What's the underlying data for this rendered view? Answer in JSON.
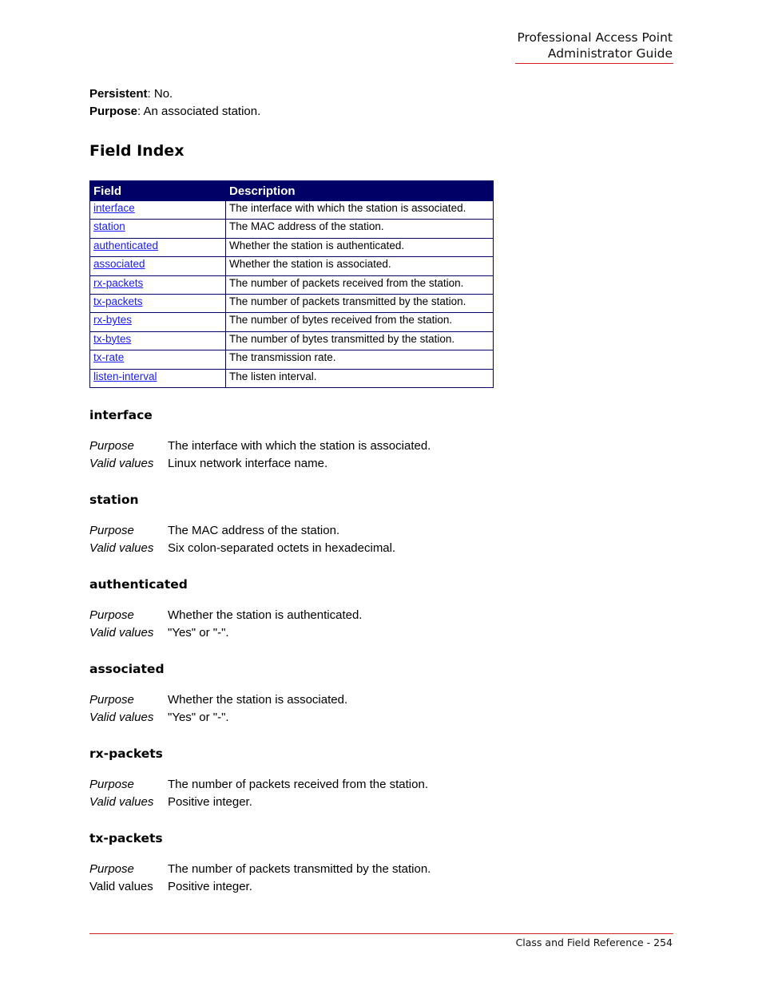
{
  "header": {
    "line1": "Professional Access Point",
    "line2": "Administrator Guide"
  },
  "meta": {
    "persistent_label": "Persistent",
    "persistent_value": ": No.",
    "purpose_label": "Purpose",
    "purpose_value": ": An associated station."
  },
  "section_title": "Field Index",
  "table": {
    "headers": [
      "Field",
      "Description"
    ],
    "rows": [
      {
        "field": "interface",
        "description": "The interface with which the station is associated."
      },
      {
        "field": "station",
        "description": "The MAC address of the station."
      },
      {
        "field": "authenticated",
        "description": "Whether the station is authenticated."
      },
      {
        "field": "associated",
        "description": "Whether the station is associated."
      },
      {
        "field": "rx-packets",
        "description": "The number of packets received from the station."
      },
      {
        "field": "tx-packets",
        "description": "The number of packets transmitted by the station."
      },
      {
        "field": "rx-bytes",
        "description": "The number of bytes received from the station."
      },
      {
        "field": "tx-bytes",
        "description": "The number of bytes transmitted by the station."
      },
      {
        "field": "tx-rate",
        "description": "The transmission rate."
      },
      {
        "field": "listen-interval",
        "description": "The listen interval."
      }
    ]
  },
  "fields": [
    {
      "name": "interface",
      "purpose_label": "Purpose",
      "purpose": "The interface with which the station is associated.",
      "valid_label": "Valid values",
      "valid": "Linux network interface name."
    },
    {
      "name": "station",
      "purpose_label": "Purpose",
      "purpose": "The MAC address of the station.",
      "valid_label": "Valid values",
      "valid": "Six colon-separated octets in hexadecimal."
    },
    {
      "name": "authenticated",
      "purpose_label": "Purpose",
      "purpose": "Whether the station is authenticated.",
      "valid_label": "Valid values",
      "valid": "\"Yes\" or \"-\"."
    },
    {
      "name": "associated",
      "purpose_label": "Purpose",
      "purpose": "Whether the station is associated.",
      "valid_label": "Valid values",
      "valid": "\"Yes\" or \"-\"."
    },
    {
      "name": "rx-packets",
      "purpose_label": "Purpose",
      "purpose": "The number of packets received from the station.",
      "valid_label": "Valid values",
      "valid": "Positive integer."
    },
    {
      "name": "tx-packets",
      "purpose_label": "Purpose",
      "purpose": "The number of packets transmitted by the station.",
      "valid_label": "Valid values",
      "valid": "Positive integer."
    }
  ],
  "footer": "Class and Field Reference - 254",
  "colors": {
    "header_rule": "#d42020",
    "table_header_bg": "#000066",
    "link": "#1a1aff"
  }
}
